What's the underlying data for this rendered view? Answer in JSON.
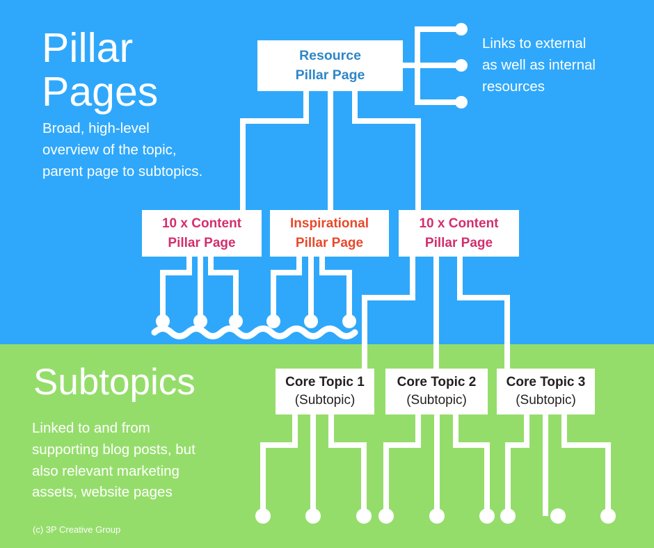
{
  "colors": {
    "blue_band": "#2fa8fb",
    "green_band": "#95dd6b",
    "wire": "#ffffff",
    "node_fill": "#ffffff",
    "resource_text": "#2e86c8",
    "content_text": "#d32e6d",
    "inspirational_text": "#e8492b",
    "core_text": "#231f20"
  },
  "pillar_section": {
    "title": "Pillar\nPages",
    "description": "Broad, high-level\noverview of the topic,\nparent page to subtopics.",
    "external_note": "Links to external\nas well as internal\nresources"
  },
  "subtopics_section": {
    "title": "Subtopics",
    "description": "Linked to and from\nsupporting blog posts, but\nalso relevant marketing\nassets, website pages"
  },
  "credit": "(c) 3P Creative Group",
  "nodes": {
    "resource": {
      "line1": "Resource",
      "line2": "Pillar Page"
    },
    "pillars": [
      {
        "line1": "10 x Content",
        "line2": "Pillar Page"
      },
      {
        "line1": "Inspirational",
        "line2": "Pillar Page"
      },
      {
        "line1": "10 x Content",
        "line2": "Pillar Page"
      }
    ],
    "core_topics": [
      {
        "line1": "Core Topic 1",
        "line2": "(Subtopic)"
      },
      {
        "line1": "Core Topic 2",
        "line2": "(Subtopic)"
      },
      {
        "line1": "Core Topic 3",
        "line2": "(Subtopic)"
      }
    ]
  },
  "endpoints": {
    "external_links_count": 3,
    "blue_leaf_dots_count": 6,
    "green_leaf_dots_count": 9
  }
}
